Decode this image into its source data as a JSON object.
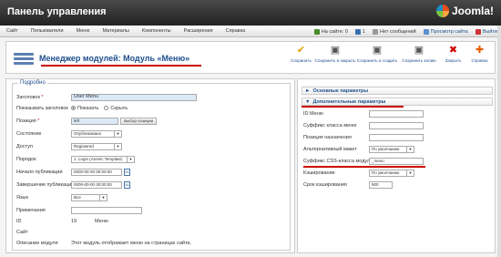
{
  "header": {
    "title": "Панель управления",
    "logo_text": "Joomla!"
  },
  "menu": {
    "items": [
      "Сайт",
      "Пользователи",
      "Меню",
      "Материалы",
      "Компоненты",
      "Расширения",
      "Справка"
    ],
    "status": {
      "visitors": "На сайте: 0",
      "admins": "1",
      "messages": "Нет сообщений",
      "preview": "Просмотр сайта",
      "logout": "Выйти"
    }
  },
  "toolbar": {
    "title": "Менеджер модулей: Модуль «Меню»",
    "buttons": [
      {
        "label": "Сохранить",
        "icon": "check-icon"
      },
      {
        "label": "Сохранить и закрыть",
        "icon": "save-close-icon"
      },
      {
        "label": "Сохранить и создать",
        "icon": "save-new-icon"
      },
      {
        "label": "Сохранить копию",
        "icon": "save-copy-icon"
      },
      {
        "label": "Закрыть",
        "icon": "close-icon"
      },
      {
        "label": "Справка",
        "icon": "help-icon"
      }
    ]
  },
  "details": {
    "legend": "Подробно",
    "title_label": "Заголовок",
    "title_value": "User Menu",
    "show_title_label": "Показывать заголовок",
    "show_option": "Показать",
    "hide_option": "Скрыть",
    "position_label": "Позиция",
    "position_value": "left",
    "position_button": "Выбор позиции",
    "state_label": "Состояние",
    "state_value": "Опубликовано",
    "access_label": "Доступ",
    "access_value": "Registered",
    "order_label": "Порядок",
    "order_value": "1. Login (Atomic Template)",
    "publish_up_label": "Начало публикации",
    "publish_up_value": "0000-00-00 00:00:00",
    "publish_down_label": "Завершение публикации",
    "publish_down_value": "0000-00-00 00:00:00",
    "language_label": "Язык",
    "language_value": "Все",
    "notes_label": "Примечания",
    "id_label": "ID",
    "id_value": "19",
    "type_value": "Меню",
    "site_label": "Сайт",
    "desc_label": "Описание модуля",
    "desc_value": "Этот модуль отображает меню на страницах сайта."
  },
  "params": {
    "basic_header": "Основные параметры",
    "advanced_header": "Дополнительные параметры",
    "menu_id_label": "ID Меню",
    "menu_class_label": "Суффикс класса меню",
    "target_label": "Позиция назначения",
    "alt_layout_label": "Альтернативный макет",
    "alt_layout_value": "По умолчанию",
    "module_class_label": "Суффикс CSS-класса модуля",
    "module_class_value": "_menu",
    "caching_label": "Кэширование",
    "caching_value": "По умолчанию",
    "cache_time_label": "Срок кэширования",
    "cache_time_value": "900"
  }
}
